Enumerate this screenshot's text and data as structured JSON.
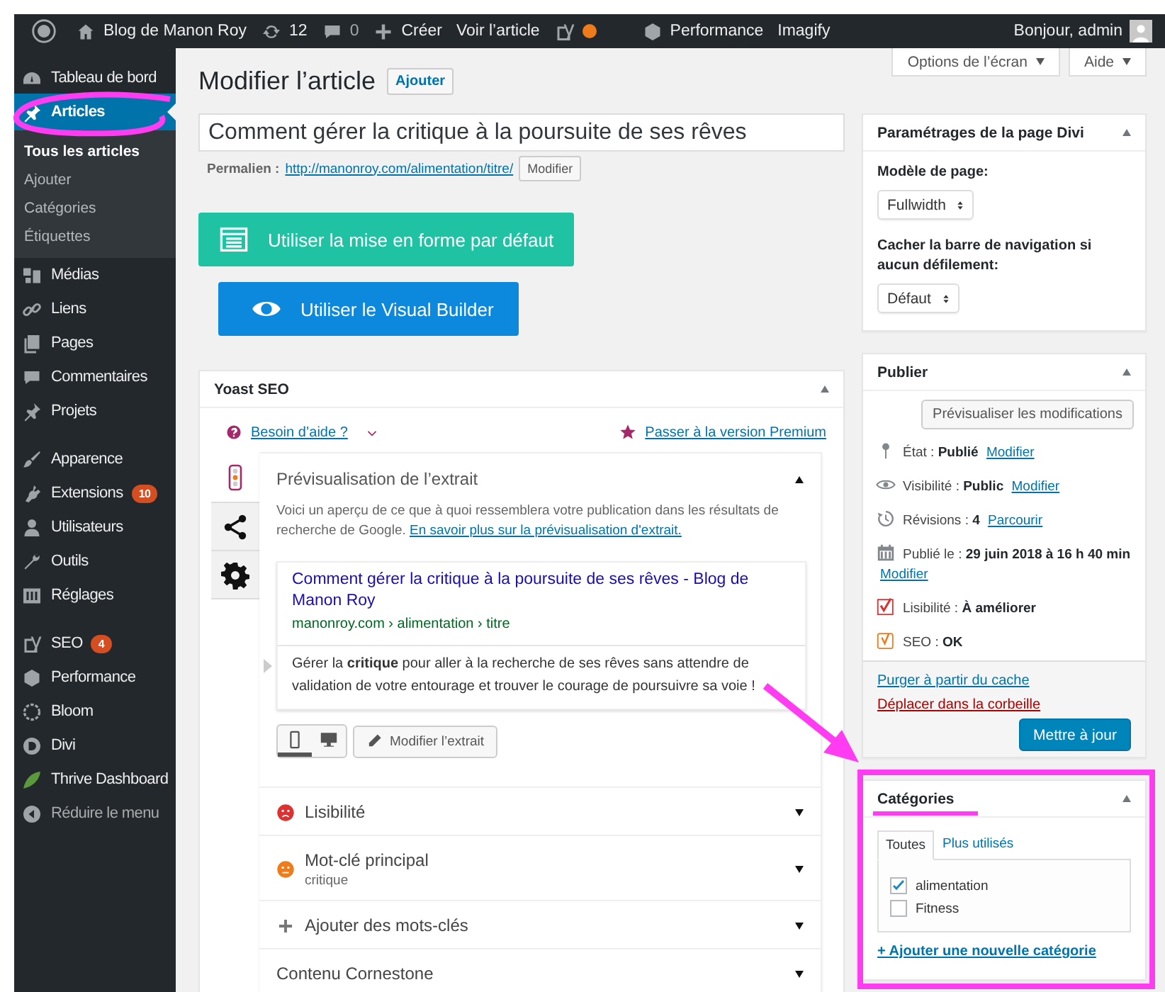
{
  "admin_bar": {
    "items": [
      {
        "kind": "logo"
      },
      {
        "kind": "link",
        "label": "Blog de Manon Roy"
      },
      {
        "kind": "link",
        "label": "12"
      },
      {
        "kind": "count",
        "label": "0"
      },
      {
        "kind": "link",
        "label": "Créer"
      },
      {
        "kind": "link",
        "label": "Voir l’article"
      },
      {
        "kind": "status",
        "color": "#ee7c1b"
      },
      {
        "kind": "link",
        "label": "Performance"
      },
      {
        "kind": "link",
        "label": "Imagify"
      }
    ],
    "greeting": "Bonjour, admin"
  },
  "sidebar": {
    "groups": [
      [
        {
          "label": "Tableau de bord",
          "selected": false
        },
        {
          "label": "Articles",
          "selected": true,
          "children": [
            {
              "label": "Tous les articles",
              "selected": true
            },
            {
              "label": "Ajouter",
              "selected": false
            },
            {
              "label": "Catégories",
              "selected": false
            },
            {
              "label": "Étiquettes",
              "selected": false
            }
          ]
        },
        {
          "label": "Médias",
          "selected": false
        },
        {
          "label": "Liens",
          "selected": false
        },
        {
          "label": "Pages",
          "selected": false
        },
        {
          "label": "Commentaires",
          "selected": false
        },
        {
          "label": "Projets",
          "selected": false
        }
      ],
      [
        {
          "label": "Apparence",
          "selected": false
        },
        {
          "label": "Extensions",
          "selected": false,
          "badge": "10"
        },
        {
          "label": "Utilisateurs",
          "selected": false
        },
        {
          "label": "Outils",
          "selected": false
        },
        {
          "label": "Réglages",
          "selected": false
        }
      ],
      [
        {
          "label": "SEO",
          "selected": false,
          "badge": "4"
        },
        {
          "label": "Performance",
          "selected": false
        },
        {
          "label": "Bloom",
          "selected": false
        },
        {
          "label": "Divi",
          "selected": false
        },
        {
          "label": "Thrive Dashboard",
          "selected": false
        }
      ]
    ],
    "collapse": "Réduire le menu"
  },
  "screen_tabs": [
    "Options de l’écran",
    "Aide"
  ],
  "page_title": "Modifier l’article",
  "add_button": "Ajouter",
  "post_title": "Comment gérer la critique à la poursuite de ses rêves",
  "permalink": {
    "label": "Permalien :",
    "url": "http://manonroy.com/alimentation/titre/",
    "button": "Modifier"
  },
  "builder_buttons": [
    {
      "kind": "default",
      "label": "Utiliser la mise en forme par défaut"
    },
    {
      "kind": "builder",
      "label": "Utiliser le Visual Builder"
    }
  ],
  "yoast": {
    "title": "Yoast SEO",
    "expanded": true,
    "help": "Besoin d’aide ?",
    "premium": "Passer à la version Premium",
    "tabs": [
      {
        "selected": true
      },
      {
        "selected": false
      },
      {
        "selected": false
      }
    ],
    "snippet": {
      "title": "Prévisualisation de l’extrait",
      "expanded": true,
      "intro": "Voici un aperçu de ce que à quoi ressemblera votre publication dans les résultats de recherche de Google.",
      "link": "En savoir plus sur la prévisualisation d'extrait.",
      "result_title": "Comment gérer la critique à la poursuite de ses rêves - Blog de Manon Roy",
      "result_url": "manonroy.com › alimentation › titre",
      "description": "Gérer la **critique** pour aller à la recherche de ses rêves sans attendre de validation de votre entourage et trouver le courage de poursuivre sa voie !",
      "modes": [
        {
          "selected": true
        },
        {
          "selected": false
        }
      ],
      "edit_button": "Modifier l’extrait"
    },
    "sections": [
      {
        "kind": "score",
        "label": "Lisibilité",
        "color": "#dc3232",
        "expanded": false
      },
      {
        "kind": "score",
        "label": "Mot-clé principal",
        "sub": "critique",
        "color": "#ee7c1b",
        "expanded": false
      },
      {
        "kind": "add",
        "label": "Ajouter des mots-clés",
        "expanded": false
      },
      {
        "kind": "plain",
        "label": "Contenu Cornestone",
        "expanded": false
      }
    ]
  },
  "divi_settings": {
    "title": "Paramétrages de la page Divi",
    "expanded": true,
    "fields": [
      {
        "label": "Modèle de page:",
        "value": "Fullwidth"
      },
      {
        "label": "Cacher la barre de navigation si aucun défilement:",
        "value": "Défaut"
      }
    ]
  },
  "publish": {
    "title": "Publier",
    "expanded": true,
    "preview_button": "Prévisualiser les modifications",
    "rows": [
      {
        "text": "État : **Publié**",
        "link": "Modifier"
      },
      {
        "text": "Visibilité : **Public**",
        "link": "Modifier"
      },
      {
        "text": "Révisions : **4**",
        "link": "Parcourir"
      },
      {
        "text": "Publié le : **29 juin 2018 à 16 h 40 min**",
        "link": "Modifier"
      },
      {
        "text": "Lisibilité : **À améliorer**"
      },
      {
        "text": "SEO : **OK**"
      }
    ],
    "purge": "Purger à partir du cache",
    "trash": "Déplacer dans la corbeille",
    "update": "Mettre à jour"
  },
  "categories": {
    "title": "Catégories",
    "expanded": true,
    "tabs": [
      {
        "label": "Toutes",
        "selected": true
      },
      {
        "label": "Plus utilisés",
        "selected": false
      }
    ],
    "items": [
      {
        "label": "alimentation",
        "checked": true
      },
      {
        "label": "Fitness",
        "checked": false
      }
    ],
    "add_link": "+ Ajouter une nouvelle catégorie"
  },
  "annotations": [
    {
      "kind": "circle"
    },
    {
      "kind": "arrow"
    },
    {
      "kind": "frame"
    },
    {
      "kind": "underline"
    }
  ]
}
